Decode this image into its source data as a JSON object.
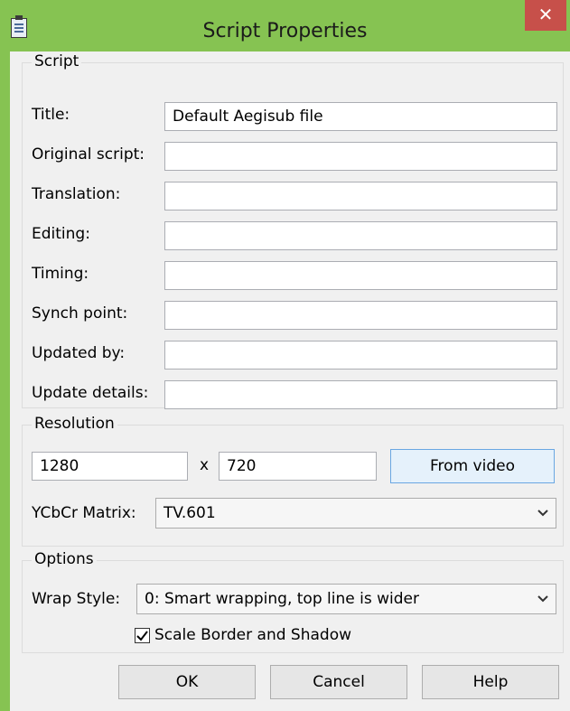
{
  "window": {
    "title": "Script Properties",
    "close_glyph": "✕",
    "frame_color": "#86c352",
    "close_color": "#c7504a"
  },
  "script_group": {
    "legend": "Script",
    "fields": [
      {
        "label": "Title:",
        "value": "Default Aegisub file"
      },
      {
        "label": "Original script:",
        "value": ""
      },
      {
        "label": "Translation:",
        "value": ""
      },
      {
        "label": "Editing:",
        "value": ""
      },
      {
        "label": "Timing:",
        "value": ""
      },
      {
        "label": "Synch point:",
        "value": ""
      },
      {
        "label": "Updated by:",
        "value": ""
      },
      {
        "label": "Update details:",
        "value": ""
      }
    ]
  },
  "resolution_group": {
    "legend": "Resolution",
    "width": "1280",
    "separator": "x",
    "height": "720",
    "from_video_label": "From video",
    "ycbcr_label": "YCbCr Matrix:",
    "ycbcr_value": "TV.601"
  },
  "options_group": {
    "legend": "Options",
    "wrap_label": "Wrap Style:",
    "wrap_value": "0: Smart wrapping, top line is wider",
    "scale_label": "Scale Border and Shadow",
    "scale_checked": true
  },
  "buttons": {
    "ok": "OK",
    "cancel": "Cancel",
    "help": "Help"
  },
  "icons": {
    "app": "script-document-icon",
    "close": "close-icon",
    "dropdown": "chevron-down-icon",
    "check": "checkmark-icon"
  }
}
